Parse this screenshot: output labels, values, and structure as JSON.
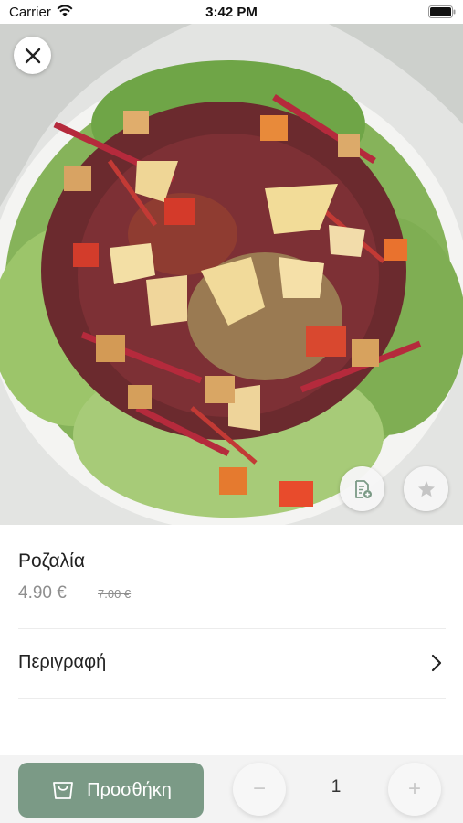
{
  "status_bar": {
    "carrier": "Carrier",
    "time": "3:42 PM"
  },
  "product": {
    "name": "Ροζαλία",
    "price": "4.90 €",
    "old_price": "7.00 €"
  },
  "description_row": {
    "label": "Περιγραφή"
  },
  "cart": {
    "add_label": "Προσθήκη",
    "quantity": "1",
    "minus_symbol": "−",
    "plus_symbol": "+"
  },
  "icons": {
    "close": "close-icon",
    "note": "note-add-icon",
    "favorite": "star-icon",
    "chevron": "chevron-right-icon",
    "bag": "shopping-bag-icon"
  },
  "colors": {
    "accent": "#7b9a86",
    "price_text": "#8e8e8e",
    "bottom_bar": "#f3f3f3"
  }
}
